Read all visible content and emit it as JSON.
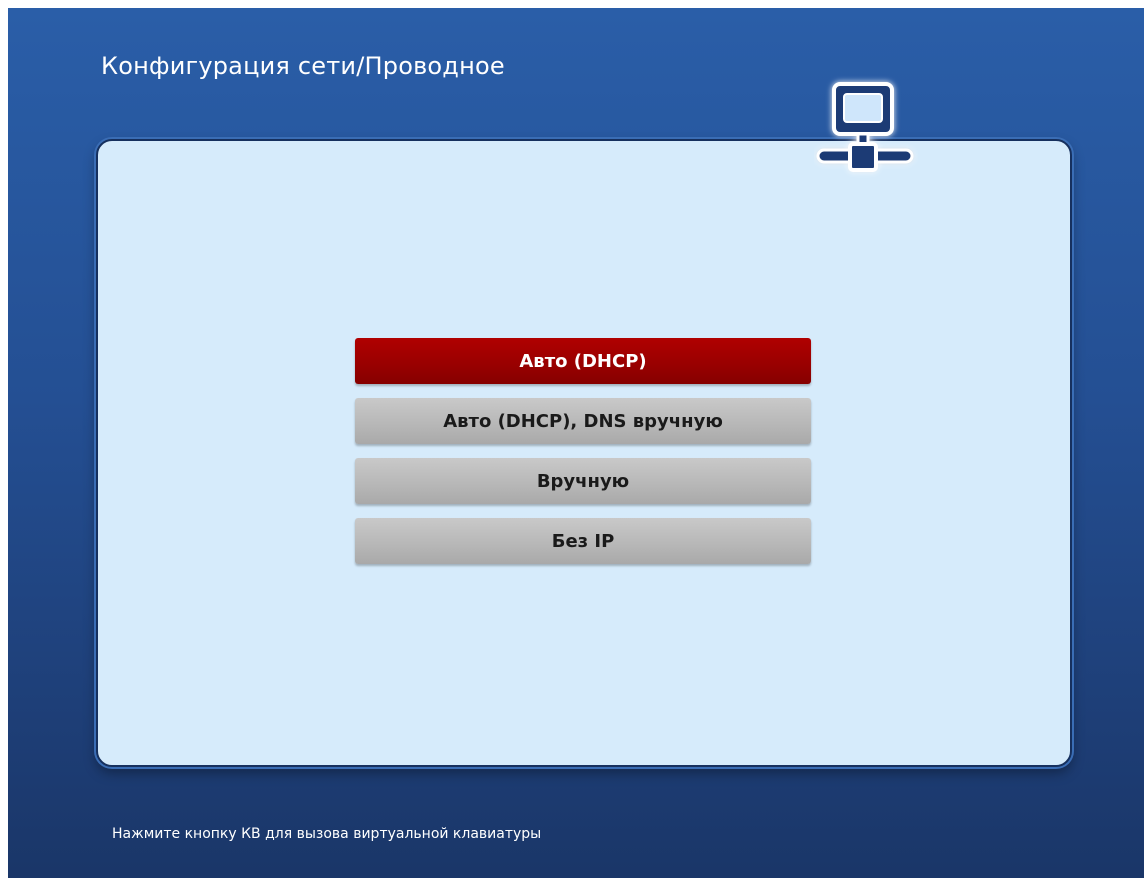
{
  "header": {
    "title": "Конфигурация сети/Проводное",
    "icon": "wired-network-icon"
  },
  "menu": {
    "selected_index": 0,
    "items": [
      {
        "label": "Авто (DHCP)"
      },
      {
        "label": "Авто (DHCP), DNS вручную"
      },
      {
        "label": "Вручную"
      },
      {
        "label": "Без IP"
      }
    ]
  },
  "footer": {
    "hint": "Нажмите кнопку КВ для вызова виртуальной клавиатуры"
  },
  "colors": {
    "background_top": "#2a5ea8",
    "background_bottom": "#1a3668",
    "panel": "#d6ebfb",
    "selected": "#9a0000",
    "button": "#b8b8b8"
  }
}
